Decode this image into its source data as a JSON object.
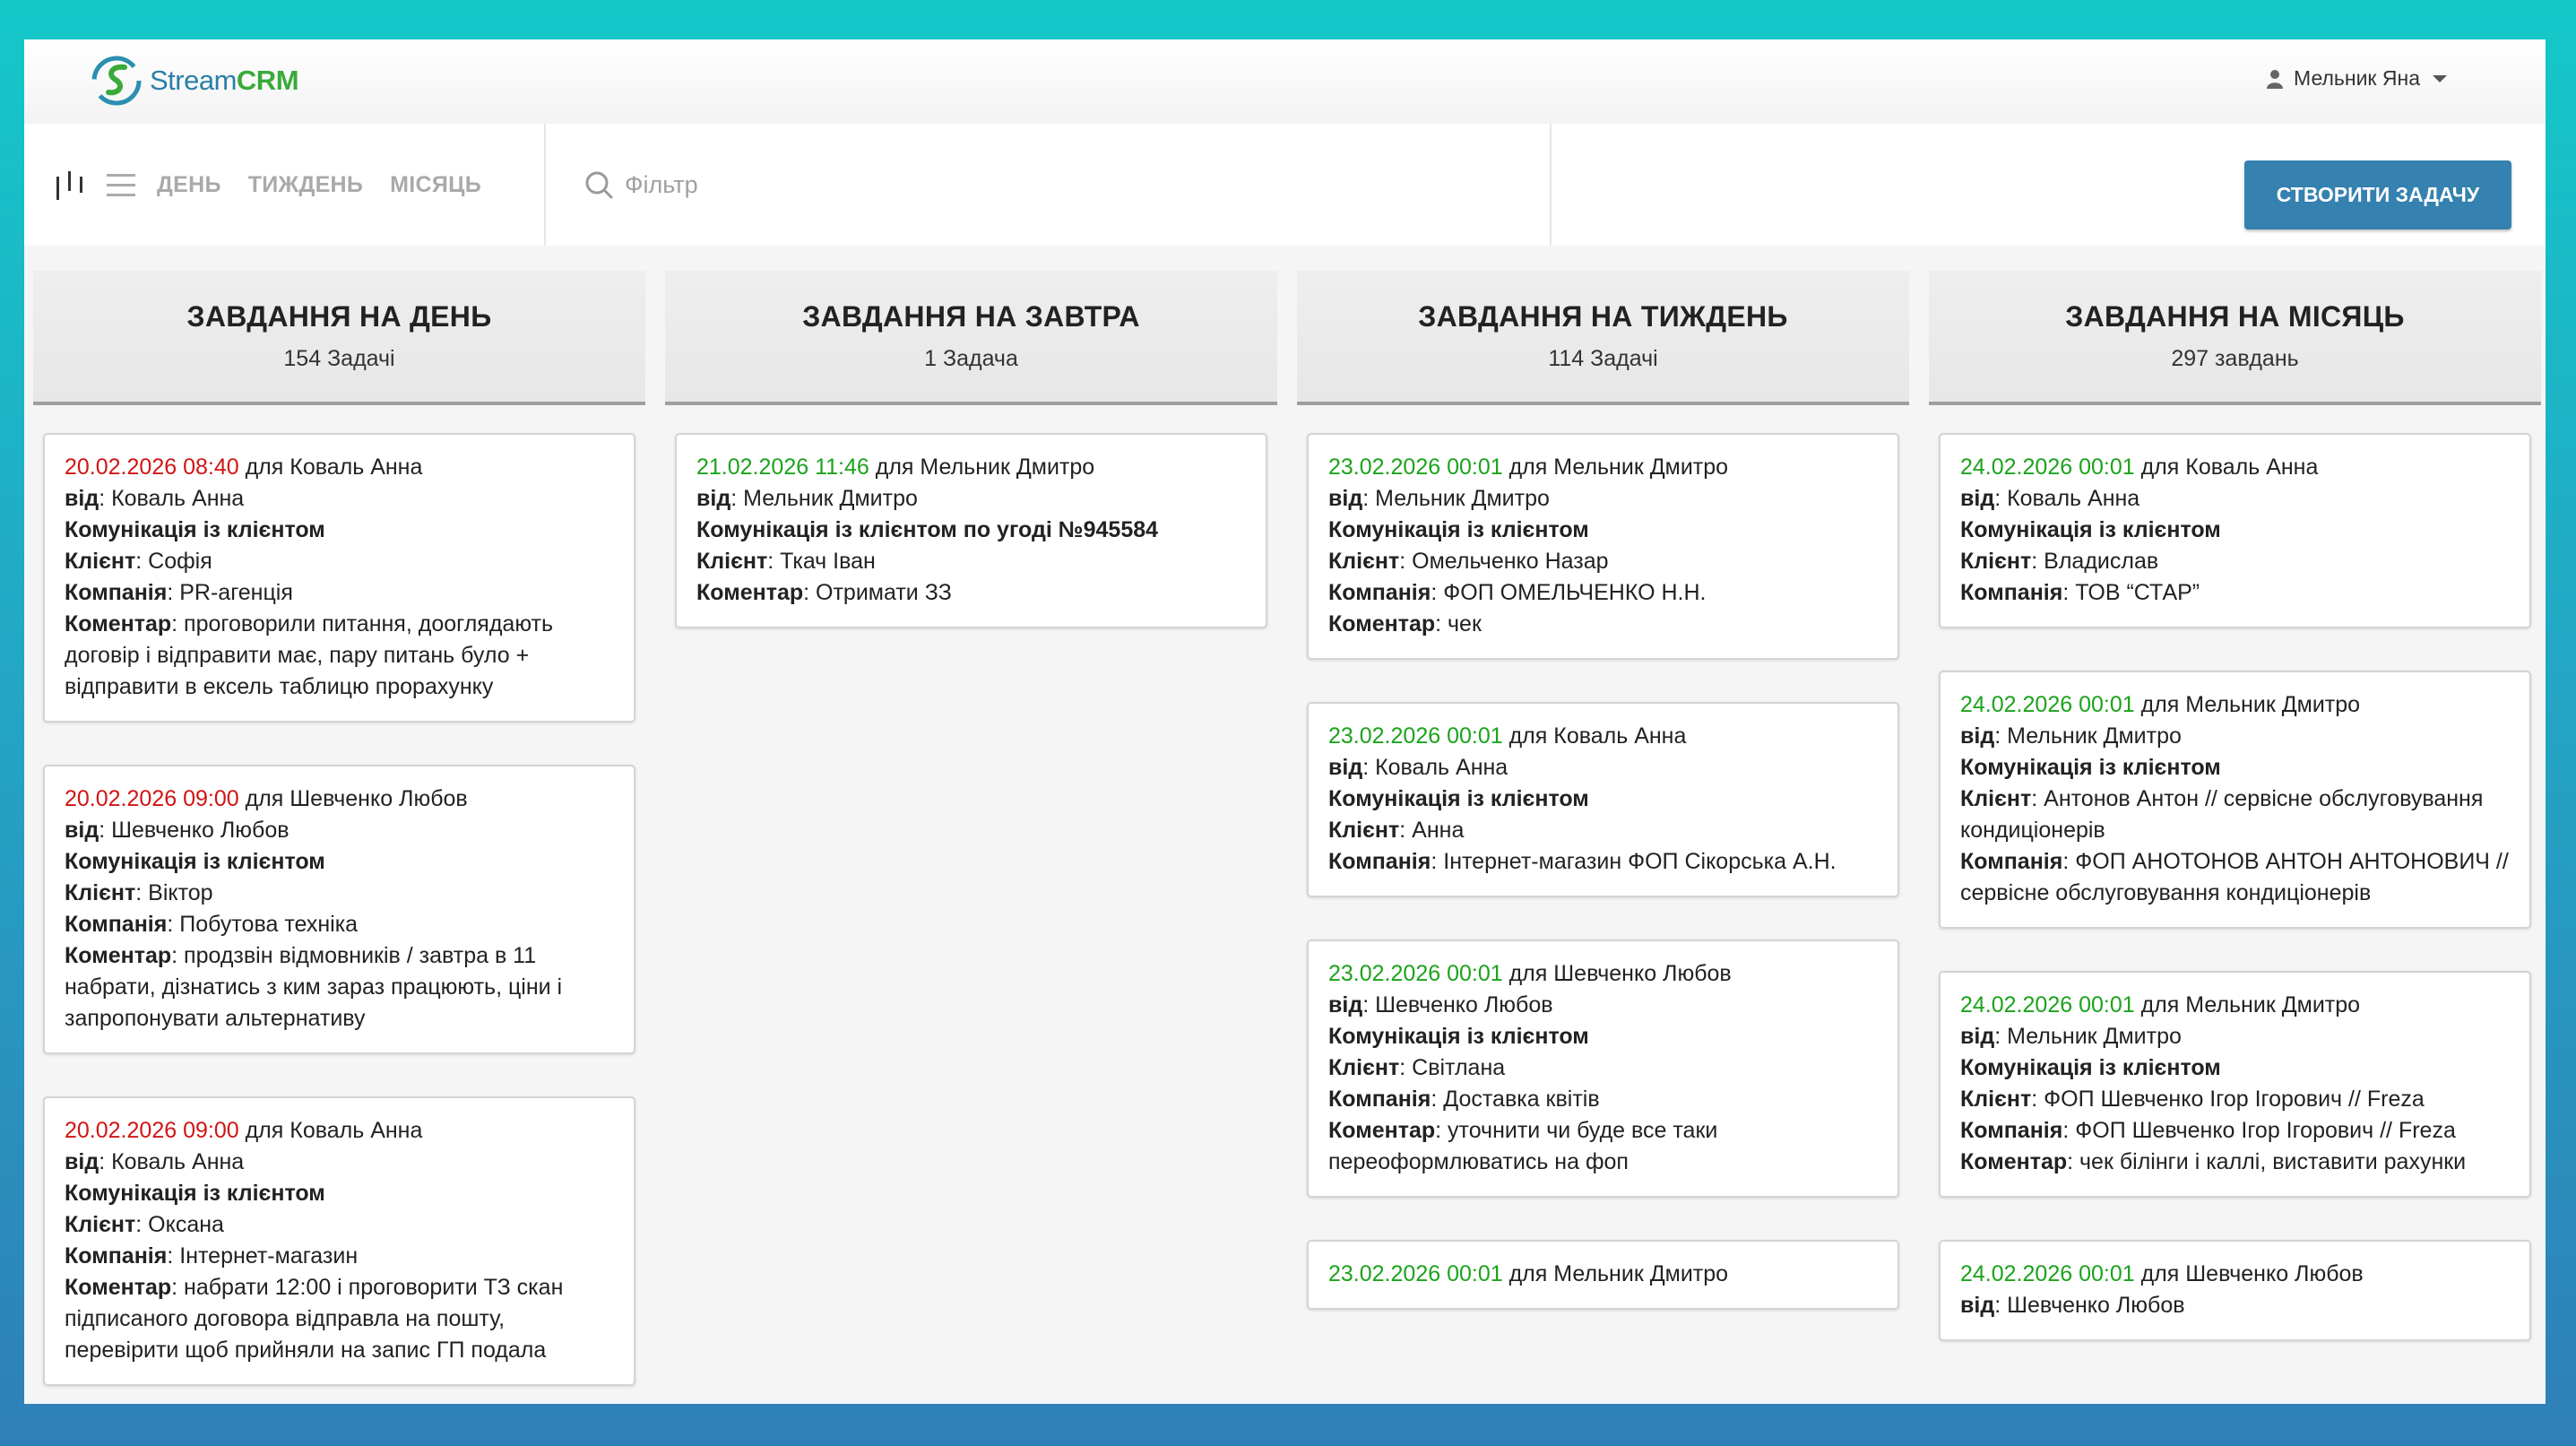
{
  "app": {
    "logo_text_1": "Stream",
    "logo_text_2": "CRM",
    "user_name": "Мельник Яна"
  },
  "toolbar": {
    "periods": [
      "ДЕНЬ",
      "ТИЖДЕНЬ",
      "МІСЯЦЬ"
    ],
    "filter_placeholder": "Фільтр",
    "create_label": "СТВОРИТИ ЗАДАЧУ"
  },
  "labels": {
    "for": "для",
    "from": "від",
    "client": "Клієнт",
    "company": "Компанія",
    "comment": "Коментар"
  },
  "colors": {
    "overdue": "#d21414",
    "upcoming": "#1ba31b",
    "accent": "#3581b0"
  },
  "columns": [
    {
      "title": "ЗАВДАННЯ НА ДЕНЬ",
      "count": "154 Задачі",
      "cards": [
        {
          "date": "20.02.2026 08:40",
          "date_status": "overdue",
          "for": "Коваль Анна",
          "from": "Коваль Анна",
          "subject": "Комунікація із клієнтом",
          "client": "Софія",
          "company": "PR-агенція",
          "comment": "проговорили питання, дооглядають договір і відправити має, пару питань було + відправити в ексель таблицю прорахунку"
        },
        {
          "date": "20.02.2026 09:00",
          "date_status": "overdue",
          "for": "Шевченко Любов",
          "from": "Шевченко Любов",
          "subject": "Комунікація із клієнтом",
          "client": "Віктор",
          "company": "Побутова техніка",
          "comment": "продзвін відмовників / завтра в 11 набрати, дізнатись з ким зараз працюють, ціни і запропонувати альтернативу"
        },
        {
          "date": "20.02.2026 09:00",
          "date_status": "overdue",
          "for": "Коваль Анна",
          "from": "Коваль Анна",
          "subject": "Комунікація із клієнтом",
          "client": "Оксана",
          "company": "Інтернет-магазин",
          "comment": "набрати 12:00 і проговорити ТЗ скан підписаного договора відправла на пошту, перевірити щоб прийняли на запис ГП подала"
        }
      ]
    },
    {
      "title": "ЗАВДАННЯ НА ЗАВТРА",
      "count": "1 Задача",
      "cards": [
        {
          "date": "21.02.2026 11:46",
          "date_status": "upcoming",
          "for": "Мельник Дмитро",
          "from": "Мельник Дмитро",
          "subject": "Комунікація із клієнтом по угоді №945584",
          "client": "Ткач Іван",
          "comment": "Отримати ЗЗ"
        }
      ]
    },
    {
      "title": "ЗАВДАННЯ НА ТИЖДЕНЬ",
      "count": "114 Задачі",
      "cards": [
        {
          "date": "23.02.2026 00:01",
          "date_status": "upcoming",
          "for": "Мельник Дмитро",
          "from": "Мельник Дмитро",
          "subject": "Комунікація із клієнтом",
          "client": "Омельченко Назар",
          "company": "ФОП ОМЕЛЬЧЕНКО Н.Н.",
          "comment": "чек"
        },
        {
          "date": "23.02.2026 00:01",
          "date_status": "upcoming",
          "for": "Коваль Анна",
          "from": "Коваль Анна",
          "subject": "Комунікація із клієнтом",
          "client": "Анна",
          "company": "Інтернет-магазин ФОП Сікорська А.Н."
        },
        {
          "date": "23.02.2026 00:01",
          "date_status": "upcoming",
          "for": "Шевченко Любов",
          "from": "Шевченко Любов",
          "subject": "Комунікація із клієнтом",
          "client": "Світлана",
          "company": "Доставка квітів",
          "comment": "уточнити чи буде все таки переоформлюватись на фоп"
        },
        {
          "date": "23.02.2026 00:01",
          "date_status": "upcoming",
          "for": "Мельник Дмитро"
        }
      ]
    },
    {
      "title": "ЗАВДАННЯ НА МІСЯЦЬ",
      "count": "297 завдань",
      "cards": [
        {
          "date": "24.02.2026 00:01",
          "date_status": "upcoming",
          "for": "Коваль Анна",
          "from": "Коваль Анна",
          "subject": "Комунікація із клієнтом",
          "client": "Владислав",
          "company": "ТОВ “СТАР”"
        },
        {
          "date": "24.02.2026 00:01",
          "date_status": "upcoming",
          "for": "Мельник Дмитро",
          "from": "Мельник Дмитро",
          "subject": "Комунікація із клієнтом",
          "client": "Антонов Антон // сервісне обслуговування кондиціонерів",
          "company": "ФОП АНОТОНОВ АНТОН АНТОНОВИЧ // сервісне обслуговування кондиціонерів"
        },
        {
          "date": "24.02.2026 00:01",
          "date_status": "upcoming",
          "for": "Мельник Дмитро",
          "from": "Мельник Дмитро",
          "subject": "Комунікація із клієнтом",
          "client": "ФОП Шевченко Ігор Ігорович // Freza",
          "company": "ФОП Шевченко Ігор Ігорович // Freza",
          "comment": "чек білінги і каллі, виставити рахунки"
        },
        {
          "date": "24.02.2026 00:01",
          "date_status": "upcoming",
          "for": "Шевченко Любов",
          "from": "Шевченко Любов"
        }
      ]
    }
  ]
}
